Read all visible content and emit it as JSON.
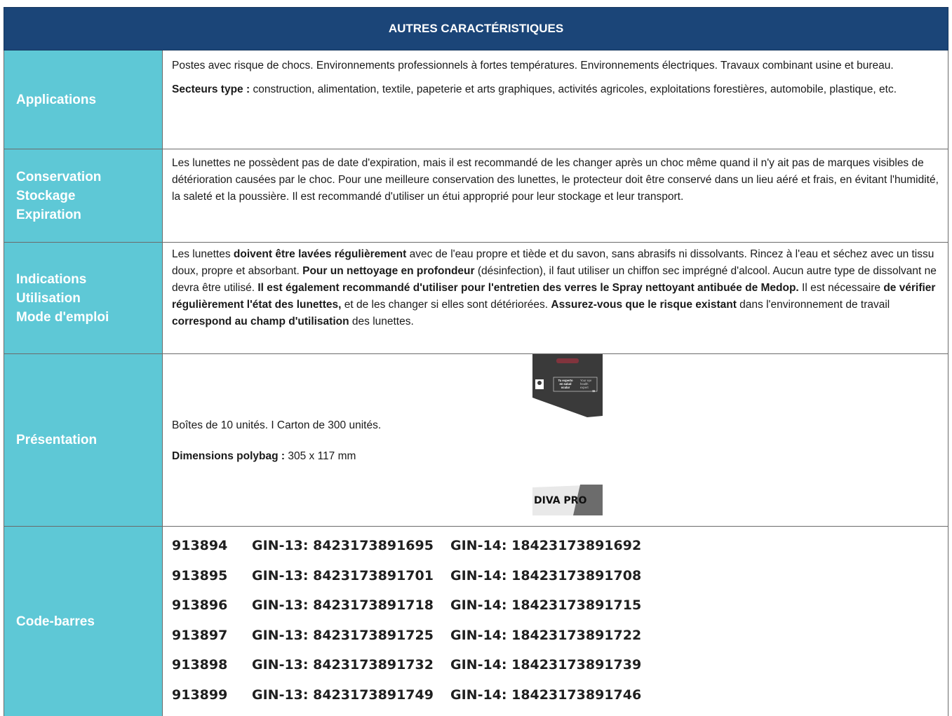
{
  "header": {
    "title": "AUTRES CARACTÉRISTIQUES"
  },
  "rows": {
    "applications": {
      "label": "Applications",
      "p1": "Postes avec risque de chocs. Environnements professionnels à fortes températures. Environnements électriques. Travaux combinant usine et bureau.",
      "p2_bold": "Secteurs type :",
      "p2_text": " construction, alimentation, textile, papeterie et arts graphiques, activités agricoles, exploitations forestières, automobile, plastique, etc."
    },
    "conservation": {
      "label_lines": [
        "Conservation",
        "Stockage",
        "Expiration"
      ],
      "text": "Les lunettes ne possèdent pas de date d'expiration, mais il est recommandé de les changer après un choc même quand il n'y ait pas de marques visibles de détérioration causées par le choc. Pour une meilleure conservation des lunettes, le protecteur doit être conservé dans un lieu aéré et frais, en évitant l'humidité, la saleté et la poussière. Il est recommandé d'utiliser un étui approprié pour leur stockage et leur transport."
    },
    "indications": {
      "label_lines": [
        "Indications",
        "Utilisation",
        "Mode d'emploi"
      ],
      "segments": [
        {
          "t": "Les lunettes ",
          "b": false
        },
        {
          "t": "doivent être lavées régulièrement",
          "b": true
        },
        {
          "t": " avec de l'eau propre et tiède et du savon, sans abrasifs ni dissolvants. Rincez à l'eau et séchez avec un tissu doux, propre et absorbant. ",
          "b": false
        },
        {
          "t": "Pour un nettoyage en profondeur",
          "b": true
        },
        {
          "t": " (désinfection), il faut utiliser un chiffon sec imprégné d'alcool. Aucun autre type de dissolvant ne devra être utilisé. ",
          "b": false
        },
        {
          "t": "Il est également recommandé d'utiliser pour l'entretien des verres le Spray nettoyant antibuée de Medop.",
          "b": true
        },
        {
          "t": " Il est nécessaire ",
          "b": false
        },
        {
          "t": "de vérifier régulièrement l'état des lunettes,",
          "b": true
        },
        {
          "t": " et de les changer si elles sont détériorées. ",
          "b": false
        },
        {
          "t": "Assurez-vous que le risque existant",
          "b": true
        },
        {
          "t": " dans l'environnement de travail ",
          "b": false
        },
        {
          "t": "correspond au champ d'utilisation",
          "b": true
        },
        {
          "t": " des lunettes.",
          "b": false
        }
      ]
    },
    "presentation": {
      "label": "Présentation",
      "boxes": "Boîtes de 10 unités.  I  Carton de 300 unités.",
      "dim_bold": "Dimensions polybag :",
      "dim_text": " 305 x 117 mm",
      "polybag_text": [
        "Tu experto",
        "en salud",
        "ocular",
        "Your eye",
        "health",
        "expert"
      ],
      "logo_text": "DIVA PRO",
      "colors": {
        "bag": "#3a3a3a",
        "logo_grey": "#6c6c6c"
      }
    },
    "barcodes": {
      "label": "Code-barres",
      "items": [
        {
          "ref": "913894",
          "gin13": "GIN-13: 8423173891695",
          "gin14": "GIN-14: 18423173891692"
        },
        {
          "ref": "913895",
          "gin13": "GIN-13: 8423173891701",
          "gin14": "GIN-14: 18423173891708"
        },
        {
          "ref": "913896",
          "gin13": "GIN-13: 8423173891718",
          "gin14": "GIN-14: 18423173891715"
        },
        {
          "ref": "913897",
          "gin13": "GIN-13: 8423173891725",
          "gin14": "GIN-14: 18423173891722"
        },
        {
          "ref": "913898",
          "gin13": "GIN-13: 8423173891732",
          "gin14": "GIN-14: 18423173891739"
        },
        {
          "ref": "913899",
          "gin13": "GIN-13: 8423173891749",
          "gin14": "GIN-14: 18423173891746"
        }
      ]
    }
  },
  "colors": {
    "header_bg": "#1b4578",
    "label_bg": "#5ec8d6"
  }
}
